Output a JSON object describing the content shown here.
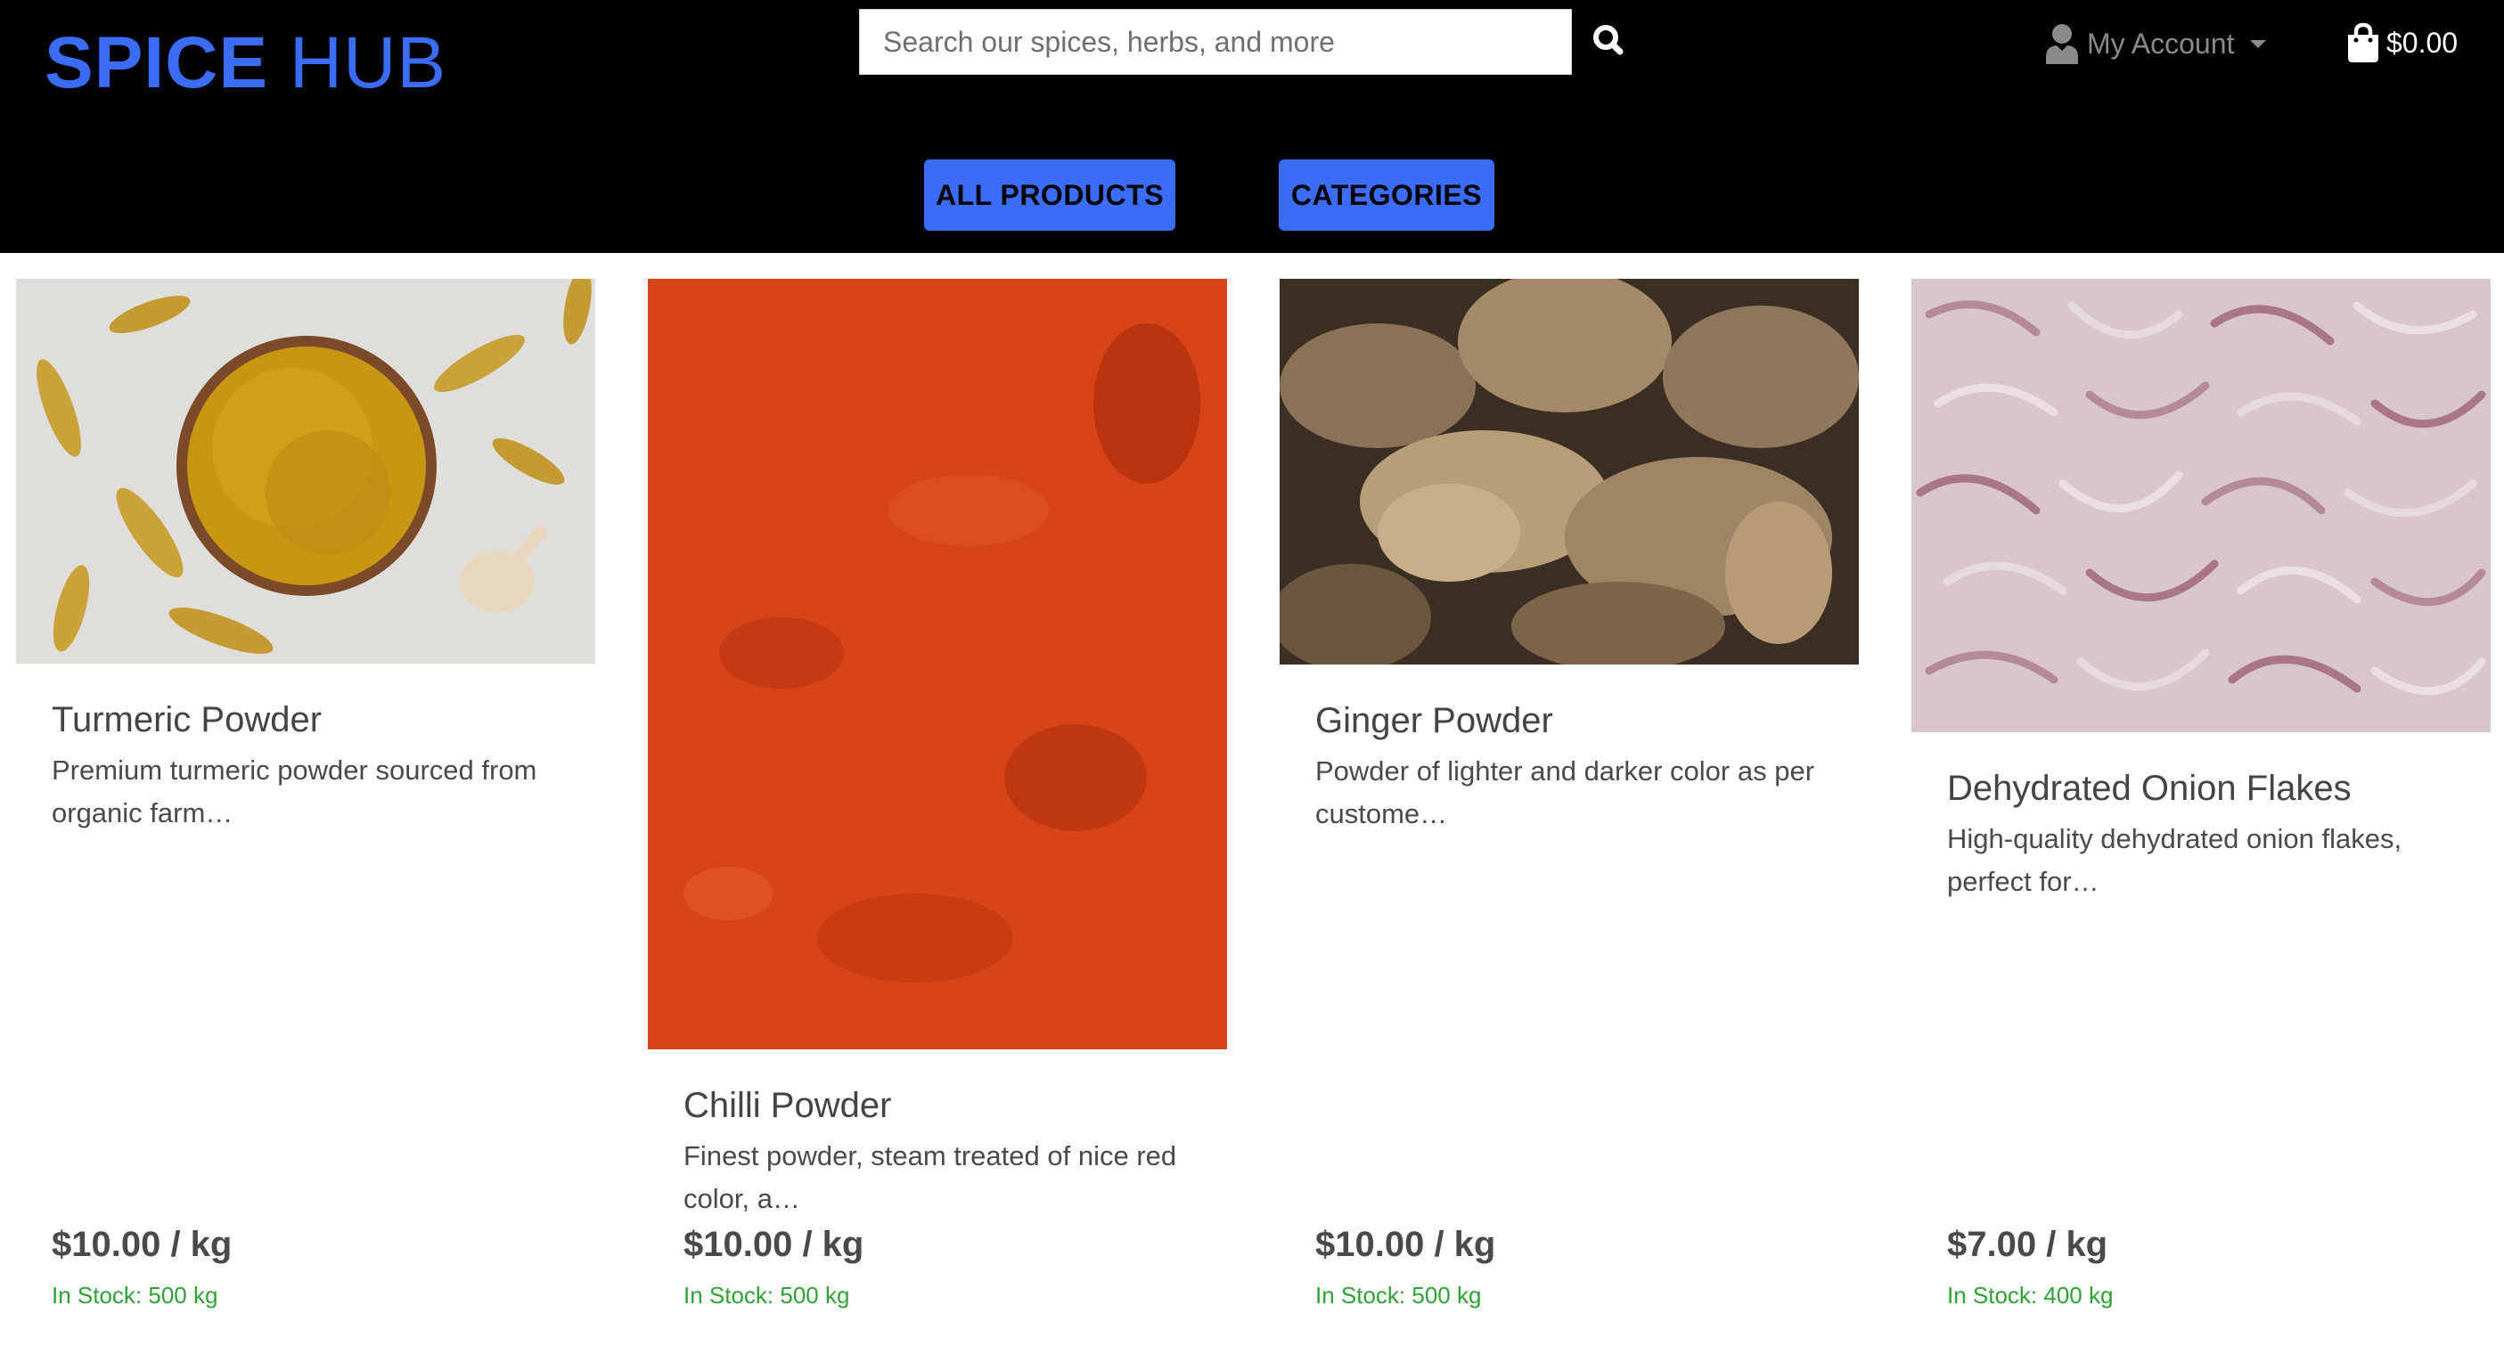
{
  "brand": {
    "part1": "SPICE",
    "part2": "HUB"
  },
  "search": {
    "placeholder": "Search our spices, herbs, and more",
    "value": ""
  },
  "account": {
    "label": "My Account"
  },
  "cart": {
    "total": "$0.00"
  },
  "nav": {
    "all_products": "ALL PRODUCTS",
    "categories": "CATEGORIES"
  },
  "colors": {
    "brand_blue": "#3b6cf6",
    "header_bg": "#000000",
    "stock_green": "#2fa236"
  },
  "products": [
    {
      "name": "Turmeric Powder",
      "description": "Premium turmeric powder sourced from organic farm…",
      "price": "$10.00 / kg",
      "stock": "In Stock: 500 kg",
      "image": "turmeric-powder-image"
    },
    {
      "name": "Chilli Powder",
      "description": "Finest powder, steam treated of nice red color, a…",
      "price": "$10.00 / kg",
      "stock": "In Stock: 500 kg",
      "image": "chilli-powder-image"
    },
    {
      "name": "Ginger Powder",
      "description": "Powder of lighter and darker color as per custome…",
      "price": "$10.00 / kg",
      "stock": "In Stock: 500 kg",
      "image": "ginger-root-image"
    },
    {
      "name": "Dehydrated Onion Flakes",
      "description": "High-quality dehydrated onion flakes, perfect for…",
      "price": "$7.00 / kg",
      "stock": "In Stock: 400 kg",
      "image": "onion-flakes-image"
    }
  ]
}
